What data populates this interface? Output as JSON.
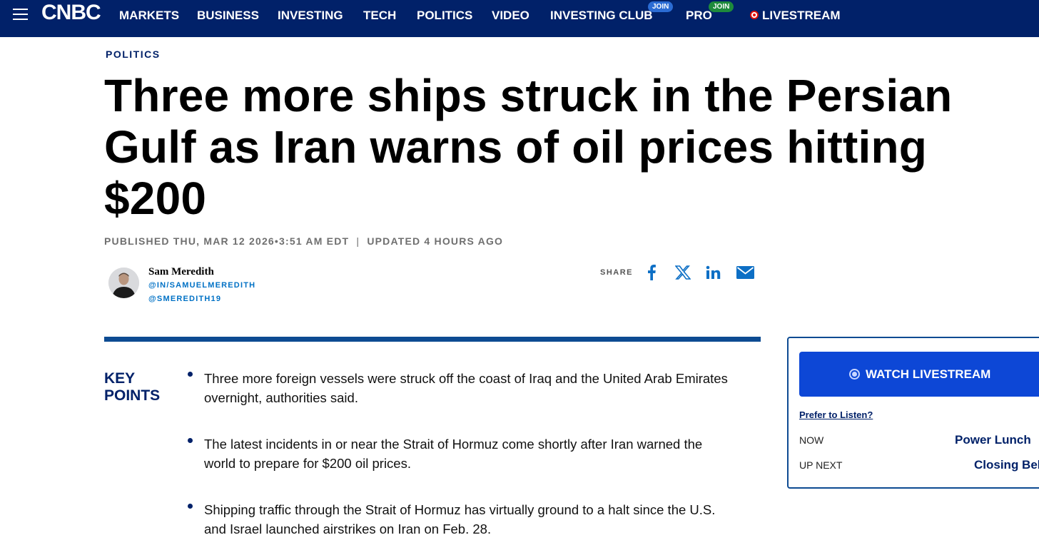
{
  "nav": {
    "logo": "CNBC",
    "items": [
      "MARKETS",
      "BUSINESS",
      "INVESTING",
      "TECH",
      "POLITICS",
      "VIDEO",
      "INVESTING CLUB",
      "PRO",
      "LIVESTREAM"
    ],
    "badges": {
      "investing_club": "JOIN",
      "pro": "JOIN"
    },
    "colors": {
      "bar": "#012169",
      "live": "#e3120b",
      "badge_blue": "#2b6cd4",
      "badge_green": "#1e8a3c"
    },
    "icons": {
      "menu": "hamburger-icon",
      "live": "live-dot-icon"
    }
  },
  "article": {
    "section": "POLITICS",
    "headline": "Three more ships struck in the Persian Gulf as Iran warns of oil prices hitting $200",
    "published": "PUBLISHED THU, MAR 12 2026•3:51 AM EDT",
    "separator": "|",
    "updated": "UPDATED 4 HOURS AGO"
  },
  "author": {
    "name": "Sam Meredith",
    "handles": [
      "@IN/SAMUELMEREDITH",
      "@SMEREDITH19"
    ]
  },
  "share": {
    "label": "SHARE",
    "icons": [
      "facebook-icon",
      "x-icon",
      "linkedin-icon",
      "email-icon"
    ]
  },
  "key_points": {
    "label_line1": "KEY",
    "label_line2": "POINTS",
    "items": [
      "Three more foreign vessels were struck off the coast of Iraq and the United Arab Emirates overnight, authorities said.",
      "The latest incidents in or near the Strait of Hormuz come shortly after Iran warned the world to prepare for $200 oil prices.",
      "Shipping traffic through the Strait of Hormuz has virtually ground to a halt since the U.S. and Israel launched airstrikes on Iran on Feb. 28."
    ]
  },
  "livestream": {
    "button": "WATCH LIVESTREAM",
    "prefer_link": "Prefer to Listen?",
    "schedule": [
      {
        "label": "NOW",
        "show": "Power Lunch"
      },
      {
        "label": "UP NEXT",
        "show": "Closing Bell"
      }
    ],
    "colors": {
      "button": "#0d47d6",
      "border": "#0d4b92"
    }
  }
}
